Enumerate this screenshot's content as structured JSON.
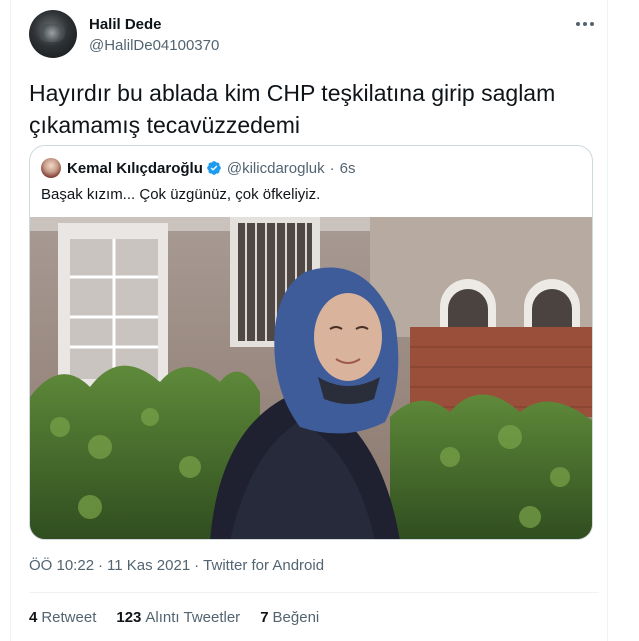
{
  "author": {
    "display_name": "Halil Dede",
    "handle": "@HalilDe04100370"
  },
  "tweet": {
    "text": "Hayırdır bu ablada kim CHP teşkilatına girip saglam çıkamamış tecavüzzedemi"
  },
  "quoted": {
    "display_name": "Kemal Kılıçdaroğlu",
    "handle": "@kilicdarogluk",
    "separator": "·",
    "time": "6s",
    "text": "Başak kızım... Çok üzgünüz, çok öfkeliyiz.",
    "verified": true
  },
  "meta": {
    "time": "ÖÖ 10:22",
    "dot1": "·",
    "date": "11 Kas 2021",
    "dot2": "·",
    "source": "Twitter for Android"
  },
  "stats": {
    "retweets": "4",
    "retweets_label": "Retweet",
    "quotes": "123",
    "quotes_label": "Alıntı Tweetler",
    "likes": "7",
    "likes_label": "Beğeni"
  },
  "colors": {
    "primary_text": "#0f1419",
    "secondary_text": "#536471",
    "verified_blue": "#1d9bf0",
    "border": "#cfd9de"
  }
}
